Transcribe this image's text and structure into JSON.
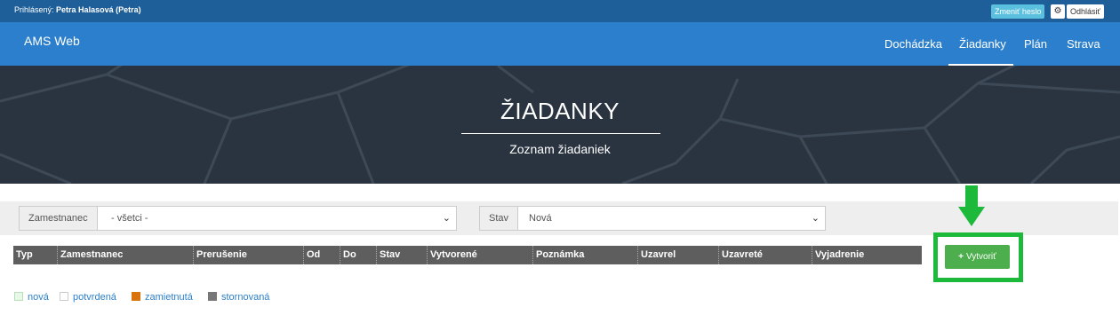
{
  "topbar": {
    "login_prefix": "Prihlásený:",
    "login_user": "Petra Halasová (Petra)",
    "change_password": "Zmeniť heslo",
    "logout": "Odhlásiť",
    "gear_glyph": "⚙"
  },
  "navbar": {
    "brand": "AMS Web",
    "items": [
      "Dochádzka",
      "Žiadanky",
      "Plán",
      "Strava"
    ],
    "active": "Žiadanky"
  },
  "hero": {
    "title": "ŽIADANKY",
    "subtitle": "Zoznam žiadaniek"
  },
  "filters": {
    "employee_label": "Zamestnanec",
    "employee_value": "- všetci -",
    "status_label": "Stav",
    "status_value": "Nová",
    "chevron_glyph": "⌄"
  },
  "table": {
    "columns": [
      "Typ",
      "Zamestnanec",
      "Prerušenie",
      "Od",
      "Do",
      "Stav",
      "Vytvorené",
      "Poznámka",
      "Uzavrel",
      "Uzavreté",
      "Vyjadrenie"
    ],
    "rows": []
  },
  "create_button": {
    "icon": "+",
    "label": "Vytvoriť"
  },
  "legend": [
    {
      "label": "nová",
      "color": "#e8f8e8",
      "border": "#b8e0b8"
    },
    {
      "label": "potvrdená",
      "color": "#ffffff",
      "border": "#cccccc"
    },
    {
      "label": "zamietnutá",
      "color": "#d9730d",
      "border": "#d9730d"
    },
    {
      "label": "stornovaná",
      "color": "#777777",
      "border": "#777777"
    }
  ],
  "colors": {
    "topbar": "#1f5f99",
    "navbar": "#2c7fcc",
    "hero": "#2a3440",
    "table_header": "#5e5e5e",
    "highlight": "#1db93a",
    "create_button": "#4cae4c"
  }
}
